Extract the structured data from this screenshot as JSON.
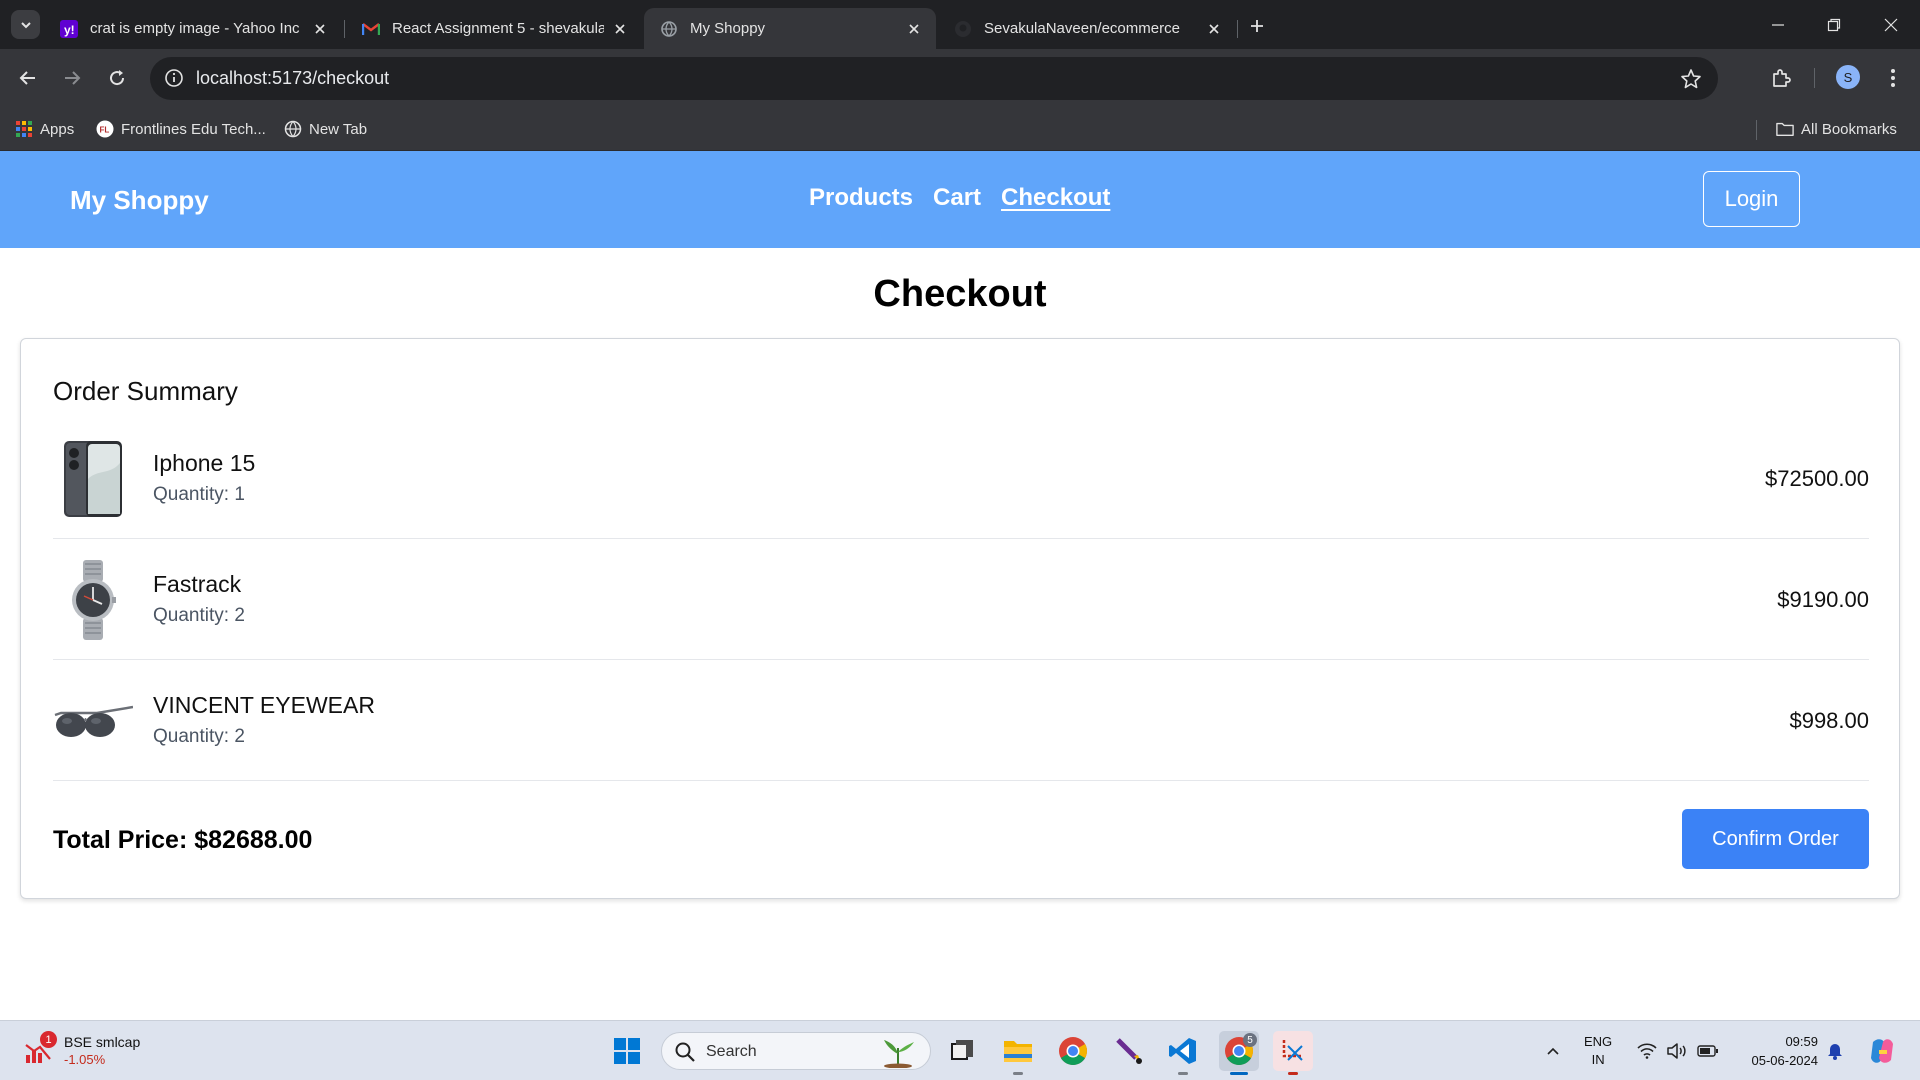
{
  "browser": {
    "tabs": [
      {
        "title": "crat is empty image - Yahoo Inc",
        "favicon": "yahoo-icon",
        "active": false
      },
      {
        "title": "React Assignment 5 - shevakula",
        "favicon": "gmail-icon",
        "active": false
      },
      {
        "title": "My Shoppy",
        "favicon": "globe-icon",
        "active": true
      },
      {
        "title": "SevakulaNaveen/ecommerce",
        "favicon": "github-icon",
        "active": false
      }
    ],
    "url": "localhost:5173/checkout",
    "profile_initial": "S",
    "bookmarks": [
      {
        "label": "Apps",
        "icon": "apps-grid-icon"
      },
      {
        "label": "Frontlines Edu Tech...",
        "icon": "frontlines-icon"
      },
      {
        "label": "New Tab",
        "icon": "globe-icon"
      }
    ],
    "all_bookmarks_label": "All Bookmarks"
  },
  "navbar": {
    "brand": "My Shoppy",
    "links": [
      {
        "label": "Products",
        "active": false
      },
      {
        "label": "Cart",
        "active": false
      },
      {
        "label": "Checkout",
        "active": true
      }
    ],
    "login_label": "Login"
  },
  "checkout": {
    "title": "Checkout",
    "summary_title": "Order Summary",
    "items": [
      {
        "name": "Iphone 15",
        "quantity": "Quantity: 1",
        "price": "$72500.00",
        "image": "phone-image"
      },
      {
        "name": "Fastrack",
        "quantity": "Quantity: 2",
        "price": "$9190.00",
        "image": "watch-image"
      },
      {
        "name": "VINCENT EYEWEAR",
        "quantity": "Quantity: 2",
        "price": "$998.00",
        "image": "sunglasses-image"
      }
    ],
    "total_label": "Total Price: $82688.00",
    "confirm_label": "Confirm Order"
  },
  "taskbar": {
    "widget": {
      "badge": "1",
      "name": "BSE smlcap",
      "change": "-1.05%"
    },
    "search_placeholder": "Search",
    "chrome_badge": "5",
    "lang_line1": "ENG",
    "lang_line2": "IN",
    "time": "09:59",
    "date": "05-06-2024"
  },
  "colors": {
    "navbar_bg": "#60a5fa",
    "confirm_button": "#3b82f6",
    "browser_dark": "#202124"
  }
}
